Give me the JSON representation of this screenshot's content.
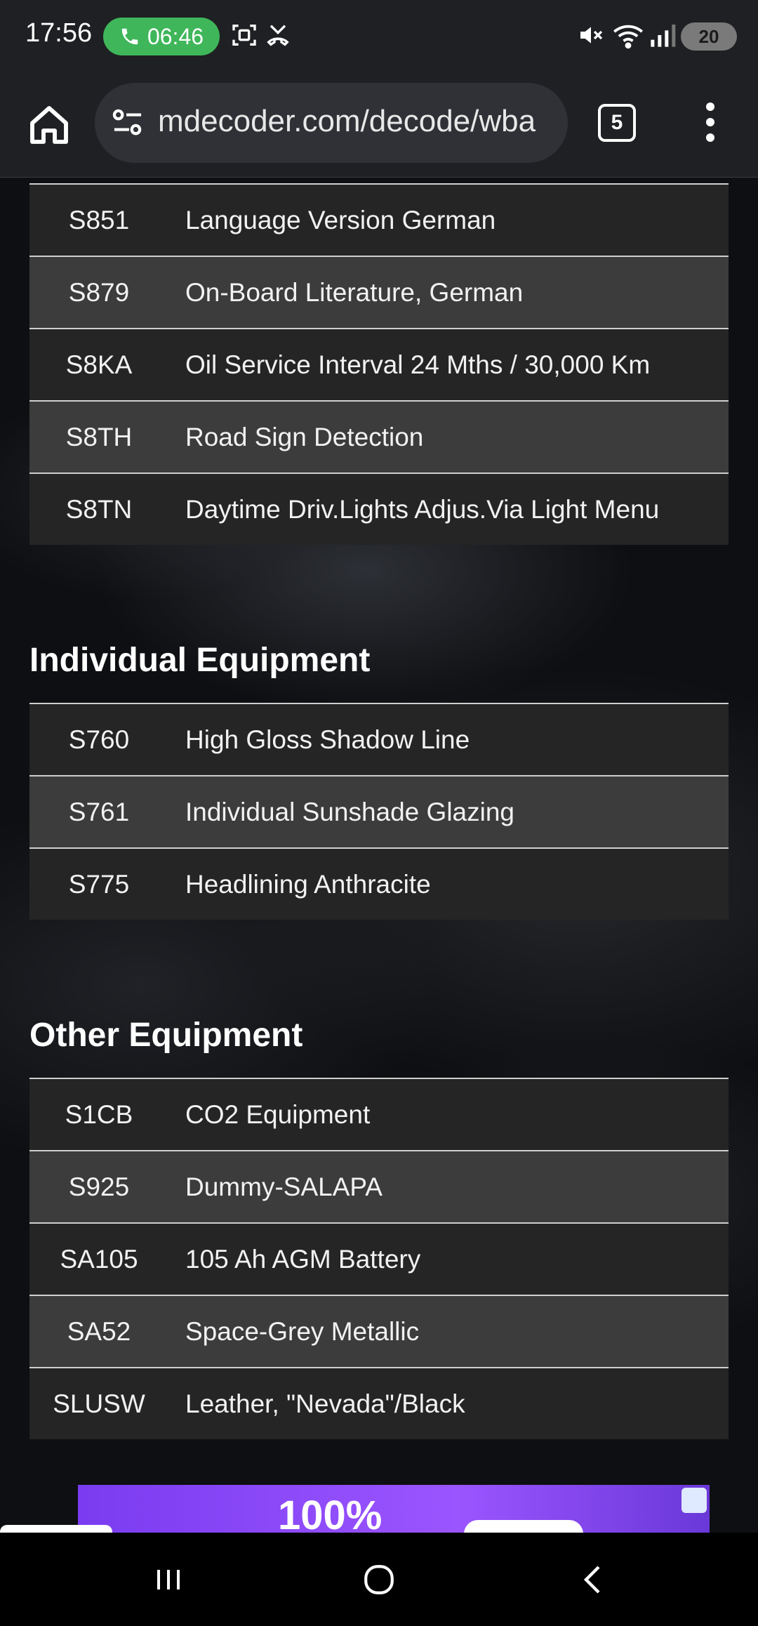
{
  "status_bar": {
    "time": "17:56",
    "call_timer": "06:46",
    "battery": "20",
    "icons": [
      "phone-icon",
      "screenshot-icon",
      "missed-call-icon",
      "mute-icon",
      "wifi-icon",
      "signal-icon",
      "battery-icon"
    ]
  },
  "browser": {
    "url": "mdecoder.com/decode/wba",
    "tab_count": "5"
  },
  "table1": {
    "rows": [
      {
        "code": "S851",
        "desc": "Language Version German"
      },
      {
        "code": "S879",
        "desc": "On-Board Literature, German"
      },
      {
        "code": "S8KA",
        "desc": "Oil Service Interval 24 Mths / 30,000 Km"
      },
      {
        "code": "S8TH",
        "desc": "Road Sign Detection"
      },
      {
        "code": "S8TN",
        "desc": "Daytime Driv.Lights Adjus.Via Light Menu"
      }
    ]
  },
  "individual": {
    "title": "Individual Equipment",
    "rows": [
      {
        "code": "S760",
        "desc": "High Gloss Shadow Line"
      },
      {
        "code": "S761",
        "desc": "Individual Sunshade Glazing"
      },
      {
        "code": "S775",
        "desc": "Headlining Anthracite"
      }
    ]
  },
  "other": {
    "title": "Other Equipment",
    "rows": [
      {
        "code": "S1CB",
        "desc": "CO2 Equipment"
      },
      {
        "code": "S925",
        "desc": "Dummy-SALAPA"
      },
      {
        "code": "SA105",
        "desc": "105 Ah AGM Battery"
      },
      {
        "code": "SA52",
        "desc": "Space-Grey Metallic"
      },
      {
        "code": "SLUSW",
        "desc": "Leather, \"Nevada\"/Black"
      }
    ]
  },
  "ad": {
    "headline": "100%"
  },
  "colors": {
    "call_pill": "#3fb65a",
    "row_dark": "#252525",
    "row_light": "#3c3c3c",
    "ad_purple": "#8a48f6"
  }
}
